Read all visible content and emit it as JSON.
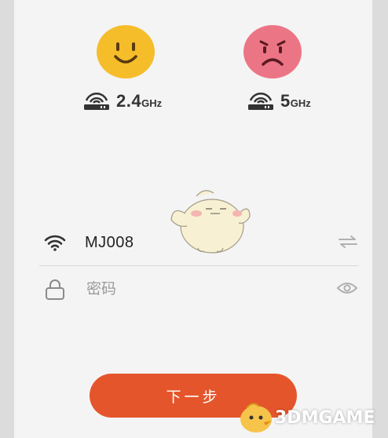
{
  "bands": [
    {
      "number": "2.4",
      "unit": "GHz",
      "face": "happy-face-icon",
      "color": "#f6bd2b"
    },
    {
      "number": "5",
      "unit": "GHz",
      "face": "sad-face-icon",
      "color": "#ec7585"
    }
  ],
  "wifi": {
    "ssid": "MJ008",
    "password_placeholder": "密码"
  },
  "actions": {
    "next_label": "下一步"
  },
  "watermark": {
    "text": "3DMGAME"
  },
  "colors": {
    "accent": "#e5552b",
    "divider": "#d6d6d6",
    "background": "#f4f4f4"
  }
}
